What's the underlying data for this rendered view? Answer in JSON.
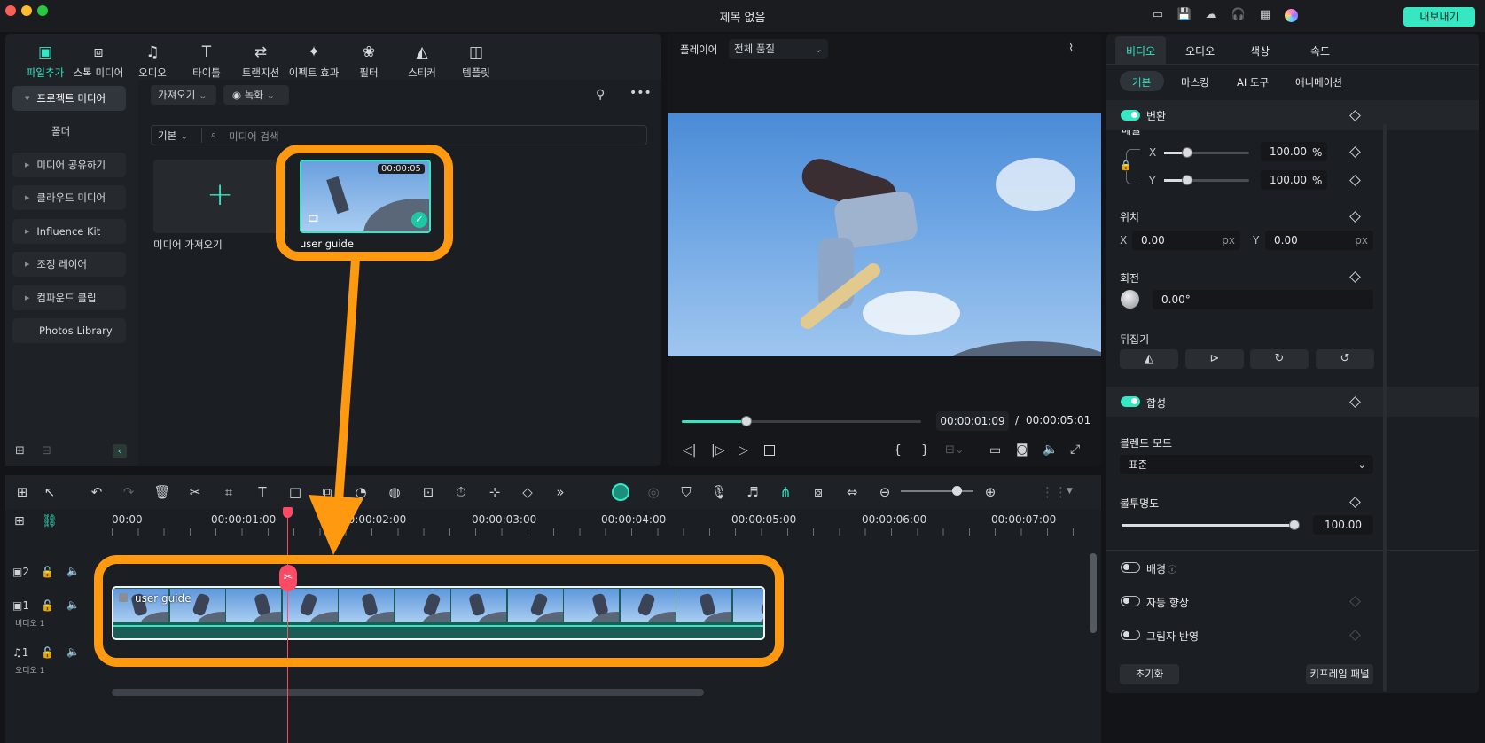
{
  "window": {
    "title": "제목 없음",
    "export_label": "내보내기"
  },
  "media_toolbar": {
    "items": [
      {
        "label": "파일추가",
        "icon": "media-icon"
      },
      {
        "label": "스톡 미디어",
        "icon": "stock-media-icon"
      },
      {
        "label": "오디오",
        "icon": "music-note-icon"
      },
      {
        "label": "타이틀",
        "icon": "title-t-icon"
      },
      {
        "label": "트랜지션",
        "icon": "transition-icon"
      },
      {
        "label": "이펙트 효과",
        "icon": "effects-sparkle-icon"
      },
      {
        "label": "필터",
        "icon": "filter-icon"
      },
      {
        "label": "스티커",
        "icon": "sticker-icon"
      },
      {
        "label": "템플릿",
        "icon": "template-icon"
      }
    ]
  },
  "sidebar": {
    "items": [
      {
        "label": "프로젝트 미디어"
      },
      {
        "label": "폴더"
      },
      {
        "label": "미디어 공유하기"
      },
      {
        "label": "클라우드 미디어"
      },
      {
        "label": "Influence Kit"
      },
      {
        "label": "조정 레이어"
      },
      {
        "label": "컴파운드 클립"
      },
      {
        "label": "Photos Library"
      }
    ]
  },
  "library": {
    "import_dropdown": "가져오기",
    "record_dropdown": "녹화",
    "view_dropdown": "기본",
    "search_placeholder": "미디어 검색",
    "import_tile_label": "미디어 가져오기",
    "clip": {
      "name": "user guide",
      "duration": "00:00:05"
    }
  },
  "player": {
    "label": "플레이어",
    "quality": "전체 품질",
    "current_time": "00:00:01:09",
    "separator": "/",
    "total_time": "00:00:05:01",
    "progress_fraction": 0.27
  },
  "inspector": {
    "tabs": [
      "비디오",
      "오디오",
      "색상",
      "속도"
    ],
    "subtabs": [
      "기본",
      "마스킹",
      "AI 도구",
      "애니메이션"
    ],
    "transform": {
      "label": "변환",
      "scale_partial": "배율",
      "scale_x_label": "X",
      "scale_x": "100.00",
      "scale_y_label": "Y",
      "scale_y": "100.00",
      "percent": "%",
      "position_label": "위치",
      "pos_x_label": "X",
      "pos_x": "0.00",
      "pos_y_label": "Y",
      "pos_y": "0.00",
      "px": "px",
      "rotation_label": "회전",
      "rotation": "0.00°",
      "flip_label": "뒤집기"
    },
    "composite": {
      "label": "합성",
      "blend_mode_label": "블렌드 모드",
      "blend_mode": "표준",
      "opacity_label": "불투명도",
      "opacity": "100.00"
    },
    "background_label": "배경",
    "auto_enhance_label": "자동 향상",
    "shadow_label": "그림자 반영",
    "reset_button": "초기화",
    "keyframe_button": "키프레임 패널"
  },
  "timeline": {
    "ruler": [
      "00:00",
      "00:00:01:00",
      "00:00:02:00",
      "00:00:03:00",
      "00:00:04:00",
      "00:00:05:00",
      "00:00:06:00",
      "00:00:07:00"
    ],
    "tracks": [
      {
        "number": "2",
        "name": ""
      },
      {
        "number": "1",
        "name": "비디오 1"
      },
      {
        "number": "1",
        "name": "오디오 1"
      }
    ],
    "clip_label": "user guide"
  },
  "colors": {
    "accent": "#35e7c3",
    "annotation": "#ff9a10",
    "playhead": "#ff4a66"
  }
}
